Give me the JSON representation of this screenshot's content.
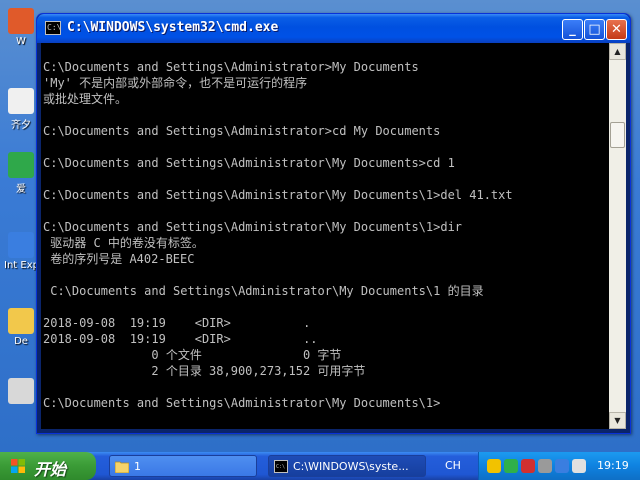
{
  "desktop": {
    "icons": [
      {
        "label": "W",
        "color": "#e05a2a"
      },
      {
        "label": "齐夕",
        "color": "#f0f0f0"
      },
      {
        "label": "爱",
        "color": "#2fa84a"
      },
      {
        "label": "Int Expl",
        "color": "#3a7ee0"
      },
      {
        "label": "De",
        "color": "#f2c84b"
      },
      {
        "label": "",
        "color": "#d8d8d8"
      }
    ]
  },
  "window": {
    "title": "C:\\WINDOWS\\system32\\cmd.exe",
    "icon_text": "C:\\",
    "minimize": "_",
    "maximize": "□",
    "close": "✕"
  },
  "console": {
    "lines": [
      "",
      "C:\\Documents and Settings\\Administrator>My Documents",
      "'My' 不是内部或外部命令，也不是可运行的程序",
      "或批处理文件。",
      "",
      "C:\\Documents and Settings\\Administrator>cd My Documents",
      "",
      "C:\\Documents and Settings\\Administrator\\My Documents>cd 1",
      "",
      "C:\\Documents and Settings\\Administrator\\My Documents\\1>del 41.txt",
      "",
      "C:\\Documents and Settings\\Administrator\\My Documents\\1>dir",
      " 驱动器 C 中的卷没有标签。",
      " 卷的序列号是 A402-BEEC",
      "",
      " C:\\Documents and Settings\\Administrator\\My Documents\\1 的目录",
      "",
      "2018-09-08  19:19    <DIR>          .",
      "2018-09-08  19:19    <DIR>          ..",
      "               0 个文件              0 字节",
      "               2 个目录 38,900,273,152 可用字节",
      "",
      "C:\\Documents and Settings\\Administrator\\My Documents\\1>"
    ]
  },
  "scrollbar": {
    "up": "▲",
    "down": "▼"
  },
  "taskbar": {
    "start_label": "开始",
    "tasks": [
      {
        "label": "1"
      },
      {
        "label": "C:\\WINDOWS\\syste..."
      }
    ],
    "lang": "CH",
    "clock": "19:19",
    "tray_colors": [
      "#f2c200",
      "#2fb04a",
      "#d03030",
      "#9a9a9a",
      "#3a7ee0",
      "#e0e0e0"
    ]
  }
}
